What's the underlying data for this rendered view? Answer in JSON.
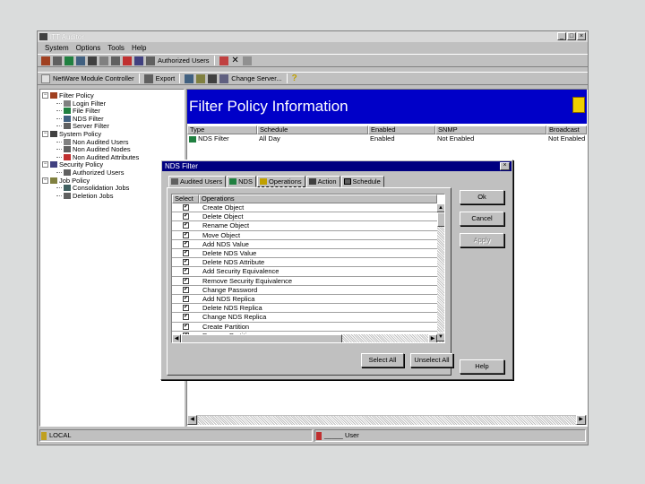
{
  "app": {
    "title": "ITT Auditor",
    "title_buttons": [
      "_",
      "□",
      "×"
    ],
    "menu": [
      "System",
      "Options",
      "Tools",
      "Help"
    ]
  },
  "toolbar1": {
    "authorized_users_label": "Authorized Users"
  },
  "toolbar2": {
    "module_label": "NetWare Module Controller",
    "export_label": "Export",
    "change_server_label": "Change Server..."
  },
  "tree": {
    "items": [
      {
        "label": "Filter Policy",
        "icon": "filter-policy-icon",
        "level": 0,
        "expander": "−"
      },
      {
        "label": "Login Filter",
        "icon": "login-filter-icon",
        "level": 1
      },
      {
        "label": "File Filter",
        "icon": "file-filter-icon",
        "level": 1
      },
      {
        "label": "NDS Filter",
        "icon": "nds-filter-icon",
        "level": 1
      },
      {
        "label": "Server Filter",
        "icon": "server-filter-icon",
        "level": 1
      },
      {
        "label": "System Policy",
        "icon": "system-policy-icon",
        "level": 0,
        "expander": "−"
      },
      {
        "label": "Non Audited Users",
        "icon": "user-icon",
        "level": 1
      },
      {
        "label": "Non Audited Nodes",
        "icon": "node-icon",
        "level": 1
      },
      {
        "label": "Non Audited Attributes",
        "icon": "attribute-icon",
        "level": 1
      },
      {
        "label": "Security Policy",
        "icon": "security-policy-icon",
        "level": 0,
        "expander": "−"
      },
      {
        "label": "Authorized Users",
        "icon": "authorized-users-icon",
        "level": 1
      },
      {
        "label": "Job Policy",
        "icon": "job-policy-icon",
        "level": 0,
        "expander": "−"
      },
      {
        "label": "Consolidation Jobs",
        "icon": "consolidation-icon",
        "level": 1
      },
      {
        "label": "Deletion Jobs",
        "icon": "deletion-icon",
        "level": 1
      }
    ]
  },
  "main": {
    "banner_title": "Filter Policy Information",
    "columns": [
      "Type",
      "Schedule",
      "Enabled",
      "SNMP",
      "Broadcast"
    ],
    "rows": [
      [
        "NDS Filter",
        "All Day",
        "Enabled",
        "Not Enabled",
        "Not Enabled"
      ]
    ]
  },
  "status": {
    "left": "LOCAL",
    "right": "_____ User"
  },
  "dialog": {
    "title": "NDS Filter",
    "close": "×",
    "tabs": [
      {
        "label": "Audited Users",
        "icon": "audited-users-icon"
      },
      {
        "label": "NDS",
        "icon": "nds-tree-icon"
      },
      {
        "label": "Operations",
        "icon": "operations-icon",
        "active": true
      },
      {
        "label": "Action",
        "icon": "action-icon"
      },
      {
        "label": "Schedule",
        "icon": "schedule-icon"
      }
    ],
    "list_headers": [
      "Select",
      "Operations"
    ],
    "operations": [
      "Create Object",
      "Delete Object",
      "Rename Object",
      "Move Object",
      "Add NDS Value",
      "Delete NDS Value",
      "Delete NDS Attribute",
      "Add Security Equivalence",
      "Remove Security Equivalence",
      "Change Password",
      "Add NDS Replica",
      "Delete NDS Replica",
      "Change NDS Replica",
      "Create Partition",
      "Remove Partition"
    ],
    "buttons": {
      "ok": "Ok",
      "cancel": "Cancel",
      "apply": "Apply",
      "select_all": "Select All",
      "unselect_all": "Unselect All",
      "help": "Help"
    }
  },
  "colors": {
    "banner": "#0000c8",
    "dialog_title": "#000080",
    "face": "#c0c0c0"
  }
}
